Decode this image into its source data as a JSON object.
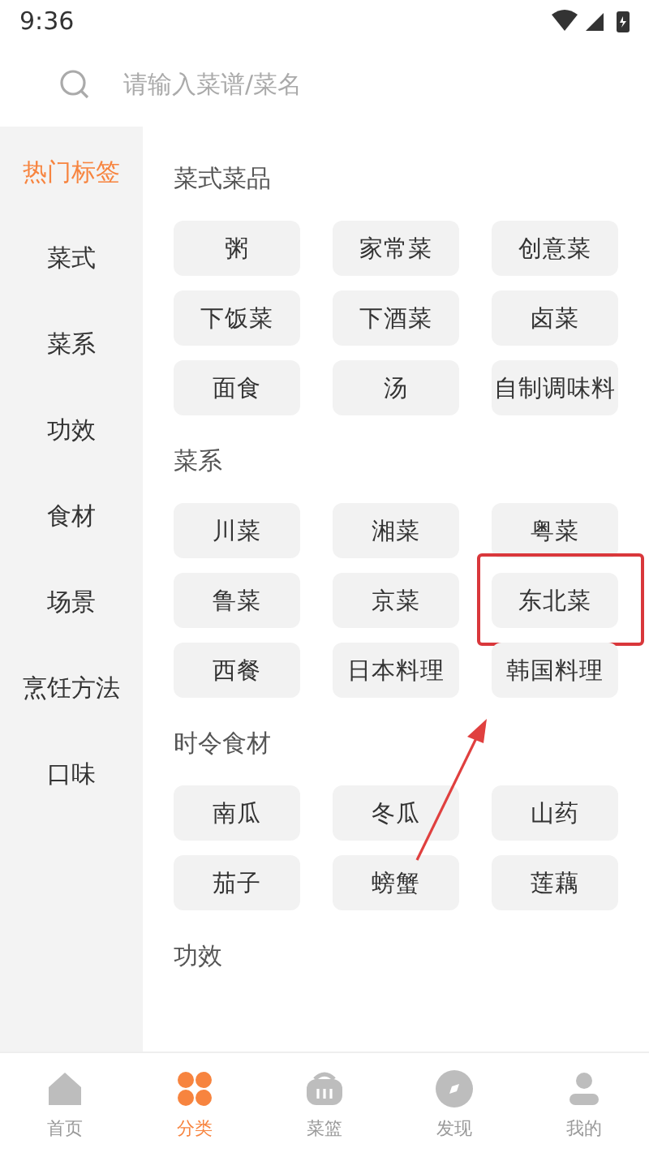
{
  "status_bar": {
    "time": "9:36"
  },
  "search": {
    "placeholder": "请输入菜谱/菜名"
  },
  "sidebar": {
    "items": [
      {
        "label": "热门标签",
        "selected": true
      },
      {
        "label": "菜式",
        "selected": false
      },
      {
        "label": "菜系",
        "selected": false
      },
      {
        "label": "功效",
        "selected": false
      },
      {
        "label": "食材",
        "selected": false
      },
      {
        "label": "场景",
        "selected": false
      },
      {
        "label": "烹饪方法",
        "selected": false
      },
      {
        "label": "口味",
        "selected": false
      }
    ]
  },
  "sections": [
    {
      "title": "菜式菜品",
      "tags": [
        {
          "label": "粥",
          "highlighted": false
        },
        {
          "label": "家常菜",
          "highlighted": false
        },
        {
          "label": "创意菜",
          "highlighted": false
        },
        {
          "label": "下饭菜",
          "highlighted": false
        },
        {
          "label": "下酒菜",
          "highlighted": false
        },
        {
          "label": "卤菜",
          "highlighted": false
        },
        {
          "label": "面食",
          "highlighted": false
        },
        {
          "label": "汤",
          "highlighted": false
        },
        {
          "label": "自制调味料",
          "highlighted": false
        }
      ]
    },
    {
      "title": "菜系",
      "tags": [
        {
          "label": "川菜",
          "highlighted": false
        },
        {
          "label": "湘菜",
          "highlighted": false
        },
        {
          "label": "粤菜",
          "highlighted": false
        },
        {
          "label": "鲁菜",
          "highlighted": false
        },
        {
          "label": "京菜",
          "highlighted": false
        },
        {
          "label": "东北菜",
          "highlighted": true
        },
        {
          "label": "西餐",
          "highlighted": false
        },
        {
          "label": "日本料理",
          "highlighted": false
        },
        {
          "label": "韩国料理",
          "highlighted": false
        }
      ]
    },
    {
      "title": "时令食材",
      "tags": [
        {
          "label": "南瓜",
          "highlighted": false
        },
        {
          "label": "冬瓜",
          "highlighted": false
        },
        {
          "label": "山药",
          "highlighted": false
        },
        {
          "label": "茄子",
          "highlighted": false
        },
        {
          "label": "螃蟹",
          "highlighted": false
        },
        {
          "label": "莲藕",
          "highlighted": false
        }
      ]
    },
    {
      "title": "功效"
    }
  ],
  "bottom_nav": [
    {
      "label": "首页",
      "kind": "home",
      "selected": false
    },
    {
      "label": "分类",
      "kind": "category",
      "selected": true
    },
    {
      "label": "菜篮",
      "kind": "basket",
      "selected": false
    },
    {
      "label": "发现",
      "kind": "discover",
      "selected": false
    },
    {
      "label": "我的",
      "kind": "profile",
      "selected": false
    }
  ]
}
